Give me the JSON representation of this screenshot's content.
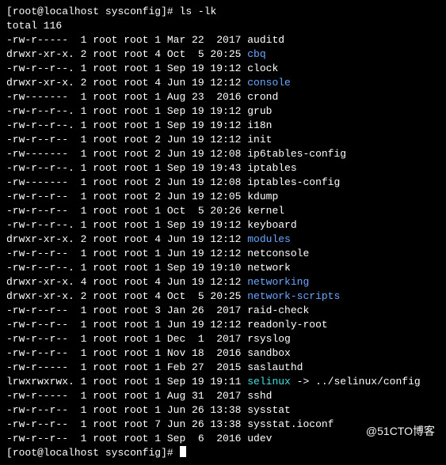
{
  "prompt": {
    "user": "root",
    "host": "localhost",
    "cwd": "sysconfig",
    "symbol": "#",
    "command": "ls -lk"
  },
  "total_line": "total 116",
  "listing": [
    {
      "perm": "-rw-r-----",
      "links": "1",
      "owner": "root",
      "group": "root",
      "size": "1",
      "mon": "Mar",
      "day": "22",
      "time": "2017",
      "name": "auditd",
      "cls": ""
    },
    {
      "perm": "drwxr-xr-x.",
      "links": "2",
      "owner": "root",
      "group": "root",
      "size": "4",
      "mon": "Oct",
      "day": "5",
      "time": "20:25",
      "name": "cbq",
      "cls": "dir"
    },
    {
      "perm": "-rw-r--r--.",
      "links": "1",
      "owner": "root",
      "group": "root",
      "size": "1",
      "mon": "Sep",
      "day": "19",
      "time": "19:12",
      "name": "clock",
      "cls": ""
    },
    {
      "perm": "drwxr-xr-x.",
      "links": "2",
      "owner": "root",
      "group": "root",
      "size": "4",
      "mon": "Jun",
      "day": "19",
      "time": "12:12",
      "name": "console",
      "cls": "dir"
    },
    {
      "perm": "-rw-------",
      "links": "1",
      "owner": "root",
      "group": "root",
      "size": "1",
      "mon": "Aug",
      "day": "23",
      "time": "2016",
      "name": "crond",
      "cls": ""
    },
    {
      "perm": "-rw-r--r--.",
      "links": "1",
      "owner": "root",
      "group": "root",
      "size": "1",
      "mon": "Sep",
      "day": "19",
      "time": "19:12",
      "name": "grub",
      "cls": ""
    },
    {
      "perm": "-rw-r--r--.",
      "links": "1",
      "owner": "root",
      "group": "root",
      "size": "1",
      "mon": "Sep",
      "day": "19",
      "time": "19:12",
      "name": "i18n",
      "cls": ""
    },
    {
      "perm": "-rw-r--r--",
      "links": "1",
      "owner": "root",
      "group": "root",
      "size": "2",
      "mon": "Jun",
      "day": "19",
      "time": "12:12",
      "name": "init",
      "cls": ""
    },
    {
      "perm": "-rw-------",
      "links": "1",
      "owner": "root",
      "group": "root",
      "size": "2",
      "mon": "Jun",
      "day": "19",
      "time": "12:08",
      "name": "ip6tables-config",
      "cls": ""
    },
    {
      "perm": "-rw-r--r--.",
      "links": "1",
      "owner": "root",
      "group": "root",
      "size": "1",
      "mon": "Sep",
      "day": "19",
      "time": "19:43",
      "name": "iptables",
      "cls": ""
    },
    {
      "perm": "-rw-------",
      "links": "1",
      "owner": "root",
      "group": "root",
      "size": "2",
      "mon": "Jun",
      "day": "19",
      "time": "12:08",
      "name": "iptables-config",
      "cls": ""
    },
    {
      "perm": "-rw-r--r--",
      "links": "1",
      "owner": "root",
      "group": "root",
      "size": "2",
      "mon": "Jun",
      "day": "19",
      "time": "12:05",
      "name": "kdump",
      "cls": ""
    },
    {
      "perm": "-rw-r--r--",
      "links": "1",
      "owner": "root",
      "group": "root",
      "size": "1",
      "mon": "Oct",
      "day": "5",
      "time": "20:26",
      "name": "kernel",
      "cls": ""
    },
    {
      "perm": "-rw-r--r--.",
      "links": "1",
      "owner": "root",
      "group": "root",
      "size": "1",
      "mon": "Sep",
      "day": "19",
      "time": "19:12",
      "name": "keyboard",
      "cls": ""
    },
    {
      "perm": "drwxr-xr-x.",
      "links": "2",
      "owner": "root",
      "group": "root",
      "size": "4",
      "mon": "Jun",
      "day": "19",
      "time": "12:12",
      "name": "modules",
      "cls": "dir"
    },
    {
      "perm": "-rw-r--r--",
      "links": "1",
      "owner": "root",
      "group": "root",
      "size": "1",
      "mon": "Jun",
      "day": "19",
      "time": "12:12",
      "name": "netconsole",
      "cls": ""
    },
    {
      "perm": "-rw-r--r--.",
      "links": "1",
      "owner": "root",
      "group": "root",
      "size": "1",
      "mon": "Sep",
      "day": "19",
      "time": "19:10",
      "name": "network",
      "cls": ""
    },
    {
      "perm": "drwxr-xr-x.",
      "links": "4",
      "owner": "root",
      "group": "root",
      "size": "4",
      "mon": "Jun",
      "day": "19",
      "time": "12:12",
      "name": "networking",
      "cls": "dir"
    },
    {
      "perm": "drwxr-xr-x.",
      "links": "2",
      "owner": "root",
      "group": "root",
      "size": "4",
      "mon": "Oct",
      "day": "5",
      "time": "20:25",
      "name": "network-scripts",
      "cls": "dir"
    },
    {
      "perm": "-rw-r--r--",
      "links": "1",
      "owner": "root",
      "group": "root",
      "size": "3",
      "mon": "Jan",
      "day": "26",
      "time": "2017",
      "name": "raid-check",
      "cls": ""
    },
    {
      "perm": "-rw-r--r--",
      "links": "1",
      "owner": "root",
      "group": "root",
      "size": "1",
      "mon": "Jun",
      "day": "19",
      "time": "12:12",
      "name": "readonly-root",
      "cls": ""
    },
    {
      "perm": "-rw-r--r--",
      "links": "1",
      "owner": "root",
      "group": "root",
      "size": "1",
      "mon": "Dec",
      "day": "1",
      "time": "2017",
      "name": "rsyslog",
      "cls": ""
    },
    {
      "perm": "-rw-r--r--",
      "links": "1",
      "owner": "root",
      "group": "root",
      "size": "1",
      "mon": "Nov",
      "day": "18",
      "time": "2016",
      "name": "sandbox",
      "cls": ""
    },
    {
      "perm": "-rw-r-----",
      "links": "1",
      "owner": "root",
      "group": "root",
      "size": "1",
      "mon": "Feb",
      "day": "27",
      "time": "2015",
      "name": "saslauthd",
      "cls": ""
    },
    {
      "perm": "lrwxrwxrwx.",
      "links": "1",
      "owner": "root",
      "group": "root",
      "size": "1",
      "mon": "Sep",
      "day": "19",
      "time": "19:11",
      "name": "selinux",
      "cls": "link",
      "target": " -> ../selinux/config"
    },
    {
      "perm": "-rw-r-----",
      "links": "1",
      "owner": "root",
      "group": "root",
      "size": "1",
      "mon": "Aug",
      "day": "31",
      "time": "2017",
      "name": "sshd",
      "cls": ""
    },
    {
      "perm": "-rw-r--r--",
      "links": "1",
      "owner": "root",
      "group": "root",
      "size": "1",
      "mon": "Jun",
      "day": "26",
      "time": "13:38",
      "name": "sysstat",
      "cls": ""
    },
    {
      "perm": "-rw-r--r--",
      "links": "1",
      "owner": "root",
      "group": "root",
      "size": "7",
      "mon": "Jun",
      "day": "26",
      "time": "13:38",
      "name": "sysstat.ioconf",
      "cls": ""
    },
    {
      "perm": "-rw-r--r--",
      "links": "1",
      "owner": "root",
      "group": "root",
      "size": "1",
      "mon": "Sep",
      "day": "6",
      "time": "2016",
      "name": "udev",
      "cls": ""
    }
  ],
  "watermark": "@51CTO博客"
}
